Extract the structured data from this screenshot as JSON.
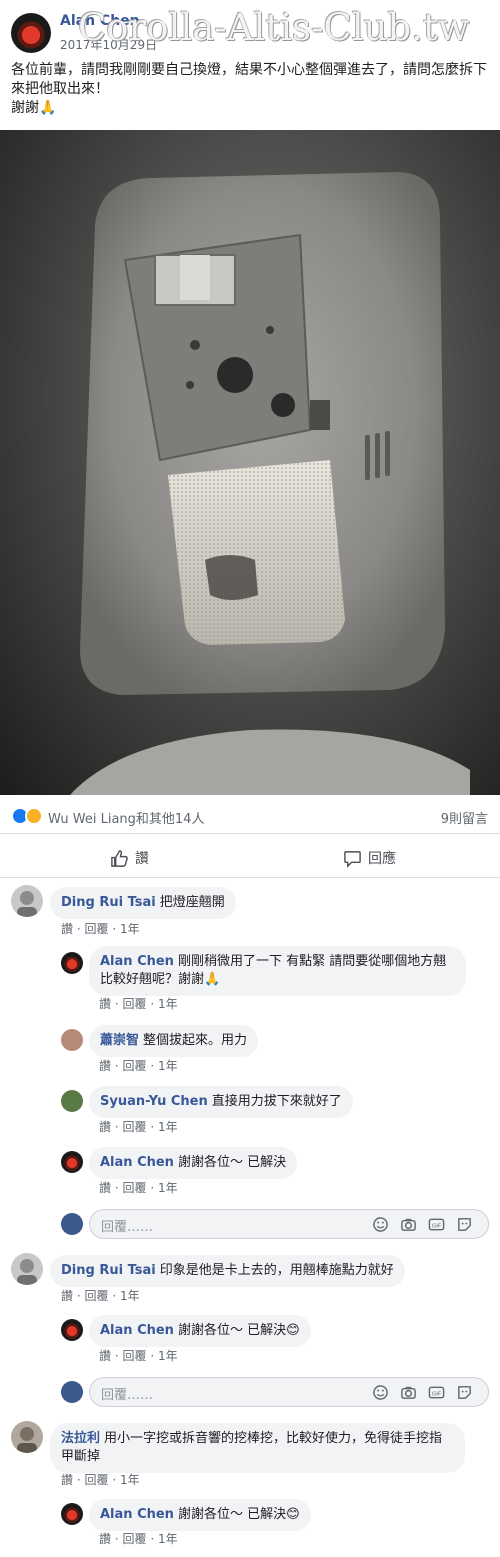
{
  "post": {
    "author": "Alan Chen",
    "date": "2017年10月29日",
    "watermark": "Corolla-Altis-Club.tw",
    "text": "各位前輩，請問我剛剛要自己換燈，結果不小心整個彈進去了，請問怎麼拆下來把他取出來！\n謝謝🙏"
  },
  "reactions": {
    "summary": "Wu Wei Liang和其他14人",
    "comment_count": "9則留言"
  },
  "actions": {
    "like": "讚",
    "reply": "回應"
  },
  "meta": {
    "like": "讚",
    "reply": "回覆",
    "time": "1年",
    "dot": "·"
  },
  "reply_placeholder": "回覆……",
  "comments": [
    {
      "name": "Ding Rui Tsai",
      "text": "把燈座翹開",
      "replies": [
        {
          "name": "Alan Chen",
          "text": "剛剛稍微用了一下 有點緊 請問要從哪個地方翹比較好翹呢？謝謝🙏"
        },
        {
          "name": "蕭崇智",
          "text": "整個拔起來。用力"
        },
        {
          "name": "Syuan-Yu Chen",
          "text": "直接用力拔下來就好了"
        },
        {
          "name": "Alan Chen",
          "text": "謝謝各位～ 已解決"
        }
      ]
    },
    {
      "name": "Ding Rui Tsai",
      "text": "印象是他是卡上去的，用翹棒施點力就好",
      "replies": [
        {
          "name": "Alan Chen",
          "text": "謝謝各位～ 已解決😊"
        }
      ]
    },
    {
      "name": "法拉利",
      "text": "用小一字挖或拆音響的挖棒挖，比較好使力，免得徒手挖指甲斷掉",
      "replies": [
        {
          "name": "Alan Chen",
          "text": "謝謝各位～ 已解決😊"
        }
      ]
    }
  ],
  "colors": {
    "link": "#385898",
    "bubble": "#f2f3f5",
    "meta": "#606770",
    "like_blue": "#1877f2",
    "wow_yellow": "#f7b125"
  },
  "icons": [
    "thumbs-up-icon",
    "wow-icon",
    "comment-icon",
    "emoji-icon",
    "camera-icon",
    "gif-icon",
    "sticker-icon"
  ]
}
